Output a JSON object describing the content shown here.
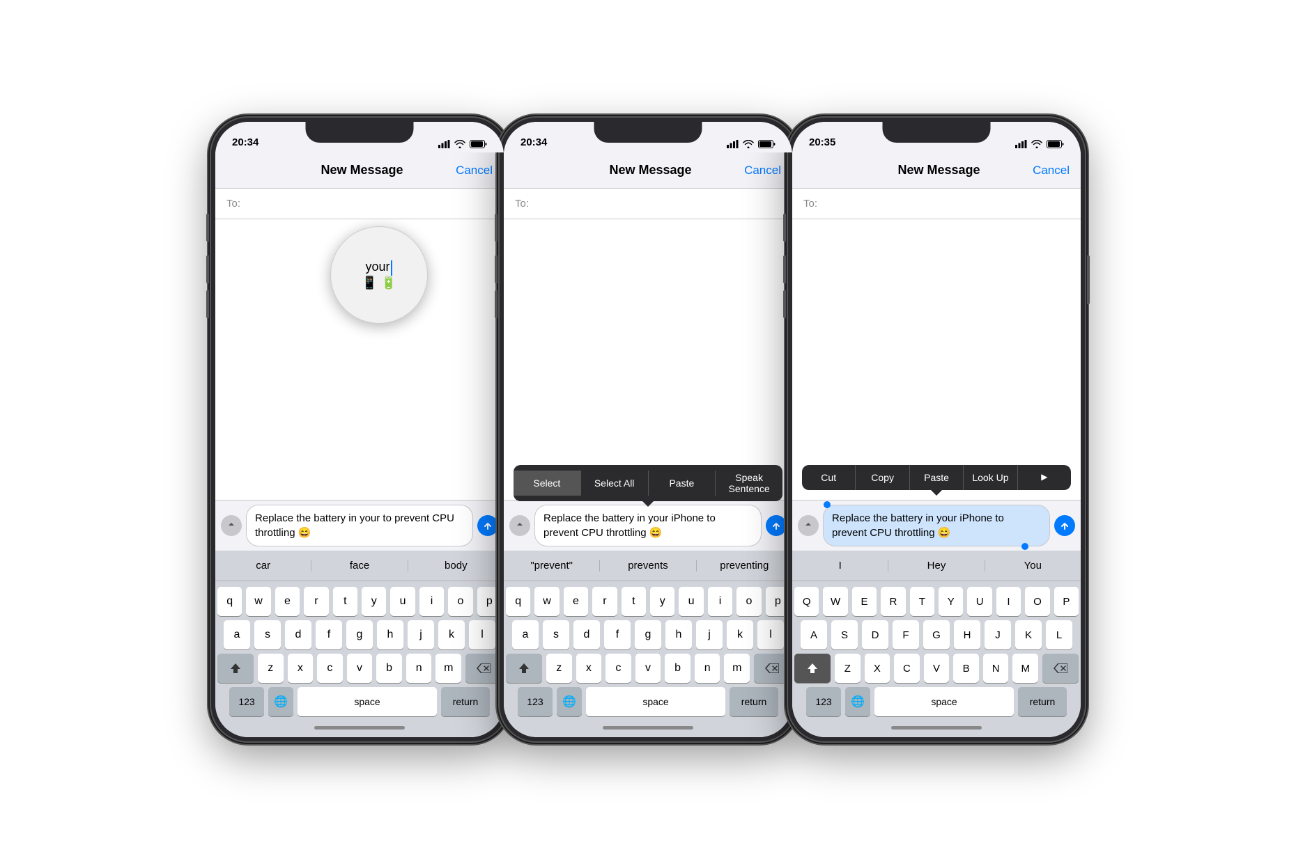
{
  "phone1": {
    "status_time": "20:34",
    "nav_title": "New Message",
    "nav_cancel": "Cancel",
    "to_label": "To:",
    "message_text": "Replace the battery in your to prevent CPU throttling 😄",
    "predictive": [
      "car",
      "face",
      "body"
    ],
    "keyboard_rows": [
      [
        "q",
        "w",
        "e",
        "r",
        "t",
        "y",
        "u",
        "i",
        "o",
        "p"
      ],
      [
        "a",
        "s",
        "d",
        "f",
        "g",
        "h",
        "j",
        "k",
        "l"
      ],
      [
        "z",
        "x",
        "c",
        "v",
        "b",
        "n",
        "m"
      ]
    ],
    "num_label": "123",
    "space_label": "space",
    "return_label": "return"
  },
  "phone2": {
    "status_time": "20:34",
    "nav_title": "New Message",
    "nav_cancel": "Cancel",
    "to_label": "To:",
    "message_text": "Replace the battery in your iPhone to prevent CPU throttling 😄",
    "context_menu": [
      "Select",
      "Select All",
      "Paste",
      "Speak Sentence"
    ],
    "predictive": [
      "\"prevent\"",
      "prevents",
      "preventing"
    ],
    "keyboard_rows": [
      [
        "q",
        "w",
        "e",
        "r",
        "t",
        "y",
        "u",
        "i",
        "o",
        "p"
      ],
      [
        "a",
        "s",
        "d",
        "f",
        "g",
        "h",
        "j",
        "k",
        "l"
      ],
      [
        "z",
        "x",
        "c",
        "v",
        "b",
        "n",
        "m"
      ]
    ],
    "num_label": "123",
    "space_label": "space",
    "return_label": "return"
  },
  "phone3": {
    "status_time": "20:35",
    "nav_title": "New Message",
    "nav_cancel": "Cancel",
    "to_label": "To:",
    "message_text": "Replace the battery in your iPhone to prevent CPU throttling 😄",
    "context_menu": [
      "Cut",
      "Copy",
      "Paste",
      "Look Up",
      "▶"
    ],
    "predictive": [
      "I",
      "Hey",
      "You"
    ],
    "keyboard_rows": [
      [
        "Q",
        "W",
        "E",
        "R",
        "T",
        "Y",
        "U",
        "I",
        "O",
        "P"
      ],
      [
        "A",
        "S",
        "D",
        "F",
        "G",
        "H",
        "J",
        "K",
        "L"
      ],
      [
        "Z",
        "X",
        "C",
        "V",
        "B",
        "N",
        "M"
      ]
    ],
    "num_label": "123",
    "space_label": "space",
    "return_label": "return"
  },
  "icons": {
    "signal": "▌▌▌",
    "wifi": "wifi",
    "battery": "battery",
    "globe": "🌐",
    "mic": "mic"
  }
}
